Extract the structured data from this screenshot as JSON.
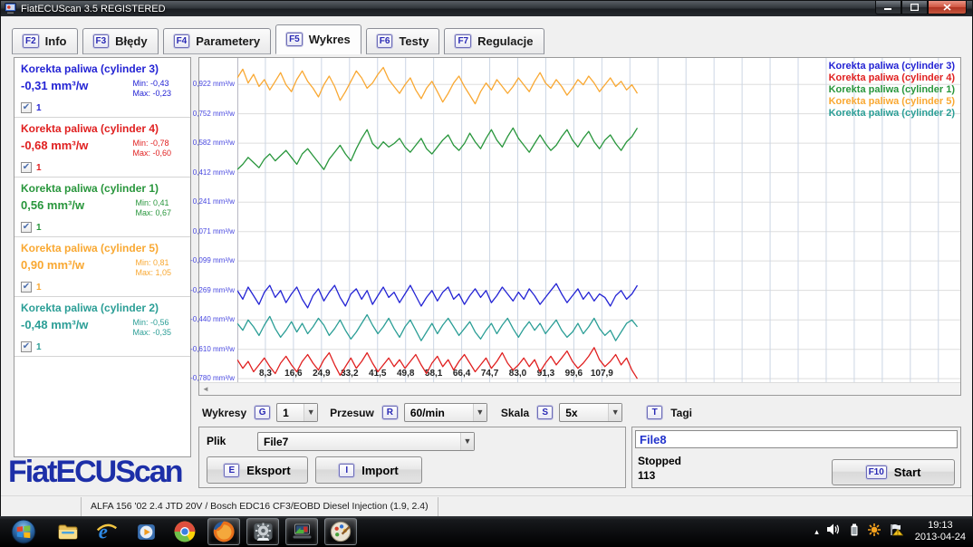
{
  "window": {
    "title": "FiatECUScan 3.5 REGISTERED"
  },
  "tabs": [
    {
      "key": "F2",
      "label": "Info",
      "active": false
    },
    {
      "key": "F3",
      "label": "Błędy",
      "active": false
    },
    {
      "key": "F4",
      "label": "Parametery",
      "active": false
    },
    {
      "key": "F5",
      "label": "Wykres",
      "active": true
    },
    {
      "key": "F6",
      "label": "Testy",
      "active": false
    },
    {
      "key": "F7",
      "label": "Regulacje",
      "active": false
    }
  ],
  "channels": [
    {
      "title": "Korekta paliwa (cylinder 3)",
      "value": "-0,31 mm³/w",
      "min": "Min: -0,43",
      "max": "Max: -0,23",
      "checkbox_label": "1",
      "checked": true,
      "color": "#2323d4"
    },
    {
      "title": "Korekta paliwa (cylinder 4)",
      "value": "-0,68 mm³/w",
      "min": "Min: -0,78",
      "max": "Max: -0,60",
      "checkbox_label": "1",
      "checked": true,
      "color": "#e02020"
    },
    {
      "title": "Korekta paliwa (cylinder 1)",
      "value": "0,56 mm³/w",
      "min": "Min: 0,41",
      "max": "Max: 0,67",
      "checkbox_label": "1",
      "checked": true,
      "color": "#28963c"
    },
    {
      "title": "Korekta paliwa (cylinder 5)",
      "value": "0,90 mm³/w",
      "min": "Min: 0,81",
      "max": "Max: 1,05",
      "checkbox_label": "1",
      "checked": true,
      "color": "#f9a832"
    },
    {
      "title": "Korekta paliwa (cylinder 2)",
      "value": "-0,48 mm³/w",
      "min": "Min: -0,56",
      "max": "Max: -0,35",
      "checkbox_label": "1",
      "checked": true,
      "color": "#2b9e96"
    }
  ],
  "chart_data": {
    "type": "line",
    "title": "",
    "xlabel": "",
    "ylabel": "mm³/w",
    "grid": true,
    "legend_position": "top-right",
    "xlim": [
      0,
      214
    ],
    "ylim": [
      -0.8,
      1.075
    ],
    "x_gridline_interval": 8.3,
    "x_step": 1.6,
    "xticks": [
      {
        "value": 8.3,
        "label": "8,3"
      },
      {
        "value": 16.6,
        "label": "16,6"
      },
      {
        "value": 24.9,
        "label": "24,9"
      },
      {
        "value": 33.2,
        "label": "33,2"
      },
      {
        "value": 41.5,
        "label": "41,5"
      },
      {
        "value": 49.8,
        "label": "49,8"
      },
      {
        "value": 58.1,
        "label": "58,1"
      },
      {
        "value": 66.4,
        "label": "66,4"
      },
      {
        "value": 74.7,
        "label": "74,7"
      },
      {
        "value": 83.0,
        "label": "83,0"
      },
      {
        "value": 91.3,
        "label": "91,3"
      },
      {
        "value": 99.6,
        "label": "99,6"
      },
      {
        "value": 107.9,
        "label": "107,9"
      }
    ],
    "yticks": [
      {
        "value": 0.922,
        "label": "0,922 mm³/w"
      },
      {
        "value": 0.752,
        "label": "0,752 mm³/w"
      },
      {
        "value": 0.582,
        "label": "0,582 mm³/w"
      },
      {
        "value": 0.412,
        "label": "0,412 mm³/w"
      },
      {
        "value": 0.241,
        "label": "0,241 mm³/w"
      },
      {
        "value": 0.071,
        "label": "0,071 mm³/w"
      },
      {
        "value": -0.099,
        "label": "-0,099 mm³/w"
      },
      {
        "value": -0.269,
        "label": "-0,269 mm³/w"
      },
      {
        "value": -0.44,
        "label": "-0,440 mm³/w"
      },
      {
        "value": -0.61,
        "label": "-0,610 mm³/w"
      },
      {
        "value": -0.78,
        "label": "-0,780 mm³/w"
      }
    ],
    "series": [
      {
        "name": "Korekta paliwa (cylinder 3)",
        "color": "#2323d4",
        "values": [
          -0.27,
          -0.32,
          -0.25,
          -0.3,
          -0.35,
          -0.28,
          -0.24,
          -0.31,
          -0.27,
          -0.34,
          -0.29,
          -0.25,
          -0.32,
          -0.37,
          -0.3,
          -0.26,
          -0.33,
          -0.28,
          -0.24,
          -0.31,
          -0.36,
          -0.29,
          -0.26,
          -0.32,
          -0.27,
          -0.35,
          -0.3,
          -0.25,
          -0.31,
          -0.28,
          -0.34,
          -0.29,
          -0.24,
          -0.3,
          -0.36,
          -0.31,
          -0.27,
          -0.33,
          -0.28,
          -0.25,
          -0.32,
          -0.29,
          -0.35,
          -0.3,
          -0.26,
          -0.31,
          -0.27,
          -0.34,
          -0.3,
          -0.25,
          -0.29,
          -0.33,
          -0.28,
          -0.32,
          -0.26,
          -0.3,
          -0.35,
          -0.31,
          -0.27,
          -0.23,
          -0.29,
          -0.34,
          -0.3,
          -0.26,
          -0.32,
          -0.28,
          -0.33,
          -0.29,
          -0.31,
          -0.36,
          -0.3,
          -0.27,
          -0.32,
          -0.29,
          -0.24
        ]
      },
      {
        "name": "Korekta paliwa (cylinder 4)",
        "color": "#e02020",
        "values": [
          -0.67,
          -0.72,
          -0.68,
          -0.74,
          -0.7,
          -0.66,
          -0.71,
          -0.75,
          -0.69,
          -0.65,
          -0.7,
          -0.74,
          -0.68,
          -0.64,
          -0.69,
          -0.73,
          -0.67,
          -0.63,
          -0.7,
          -0.76,
          -0.71,
          -0.66,
          -0.72,
          -0.68,
          -0.63,
          -0.69,
          -0.74,
          -0.7,
          -0.66,
          -0.71,
          -0.67,
          -0.72,
          -0.68,
          -0.64,
          -0.7,
          -0.75,
          -0.69,
          -0.65,
          -0.71,
          -0.67,
          -0.73,
          -0.68,
          -0.64,
          -0.69,
          -0.74,
          -0.7,
          -0.66,
          -0.72,
          -0.68,
          -0.63,
          -0.69,
          -0.73,
          -0.7,
          -0.66,
          -0.71,
          -0.67,
          -0.74,
          -0.69,
          -0.65,
          -0.7,
          -0.66,
          -0.62,
          -0.68,
          -0.72,
          -0.69,
          -0.65,
          -0.6,
          -0.67,
          -0.71,
          -0.68,
          -0.64,
          -0.7,
          -0.66,
          -0.73,
          -0.78
        ]
      },
      {
        "name": "Korekta paliwa (cylinder 1)",
        "color": "#28963c",
        "values": [
          0.43,
          0.46,
          0.5,
          0.47,
          0.44,
          0.49,
          0.52,
          0.48,
          0.51,
          0.54,
          0.5,
          0.46,
          0.52,
          0.55,
          0.51,
          0.47,
          0.43,
          0.49,
          0.53,
          0.57,
          0.52,
          0.48,
          0.55,
          0.61,
          0.66,
          0.58,
          0.55,
          0.59,
          0.56,
          0.58,
          0.61,
          0.56,
          0.53,
          0.57,
          0.61,
          0.55,
          0.52,
          0.56,
          0.6,
          0.63,
          0.57,
          0.54,
          0.58,
          0.64,
          0.59,
          0.55,
          0.61,
          0.66,
          0.6,
          0.56,
          0.62,
          0.67,
          0.61,
          0.57,
          0.53,
          0.58,
          0.63,
          0.58,
          0.54,
          0.57,
          0.62,
          0.66,
          0.6,
          0.56,
          0.61,
          0.65,
          0.59,
          0.55,
          0.6,
          0.63,
          0.58,
          0.54,
          0.59,
          0.62,
          0.67
        ]
      },
      {
        "name": "Korekta paliwa (cylinder 5)",
        "color": "#f9a832",
        "values": [
          0.96,
          1.01,
          0.93,
          0.98,
          0.91,
          0.95,
          0.89,
          0.94,
          0.99,
          0.92,
          0.88,
          0.95,
          1.0,
          0.94,
          0.9,
          0.85,
          0.92,
          0.97,
          0.91,
          0.83,
          0.88,
          0.94,
          1.0,
          0.96,
          0.9,
          0.93,
          0.98,
          1.02,
          0.95,
          0.91,
          0.87,
          0.92,
          0.96,
          0.89,
          0.84,
          0.9,
          0.94,
          0.88,
          0.82,
          0.87,
          0.93,
          0.97,
          0.91,
          0.86,
          0.81,
          0.88,
          0.93,
          0.89,
          0.95,
          0.91,
          0.87,
          0.91,
          0.96,
          0.92,
          0.88,
          0.94,
          0.99,
          0.93,
          0.9,
          0.95,
          0.91,
          0.86,
          0.9,
          0.95,
          0.92,
          0.97,
          0.93,
          0.88,
          0.92,
          0.96,
          0.91,
          0.94,
          0.89,
          0.92,
          0.87
        ]
      },
      {
        "name": "Korekta paliwa (cylinder 2)",
        "color": "#2b9e96",
        "values": [
          -0.46,
          -0.5,
          -0.44,
          -0.48,
          -0.53,
          -0.47,
          -0.42,
          -0.49,
          -0.54,
          -0.5,
          -0.45,
          -0.51,
          -0.46,
          -0.52,
          -0.48,
          -0.43,
          -0.47,
          -0.53,
          -0.49,
          -0.44,
          -0.5,
          -0.55,
          -0.51,
          -0.46,
          -0.41,
          -0.47,
          -0.52,
          -0.48,
          -0.43,
          -0.49,
          -0.54,
          -0.48,
          -0.44,
          -0.5,
          -0.56,
          -0.51,
          -0.46,
          -0.52,
          -0.47,
          -0.43,
          -0.48,
          -0.53,
          -0.49,
          -0.45,
          -0.51,
          -0.55,
          -0.5,
          -0.46,
          -0.52,
          -0.47,
          -0.43,
          -0.49,
          -0.54,
          -0.49,
          -0.45,
          -0.5,
          -0.46,
          -0.52,
          -0.48,
          -0.44,
          -0.5,
          -0.54,
          -0.51,
          -0.46,
          -0.52,
          -0.48,
          -0.43,
          -0.49,
          -0.53,
          -0.5,
          -0.56,
          -0.51,
          -0.46,
          -0.44,
          -0.48
        ]
      }
    ]
  },
  "controls": {
    "wykresy_label": "Wykresy",
    "wykresy_key": "G",
    "wykresy_value": "1",
    "przesuw_label": "Przesuw",
    "przesuw_key": "R",
    "przesuw_value": "60/min",
    "skala_label": "Skala",
    "skala_key": "S",
    "skala_value": "5x",
    "tagi_key": "T",
    "tagi_label": "Tagi"
  },
  "file_panel": {
    "plik_label": "Plik",
    "plik_value": "File7",
    "eksport_key": "E",
    "eksport_label": "Eksport",
    "import_key": "I",
    "import_label": "Import"
  },
  "session_panel": {
    "file_value": "File8",
    "status": "Stopped",
    "status_color": "#e01818",
    "count": "113",
    "count_color": "#1e8c3a",
    "start_key": "F10",
    "start_label": "Start"
  },
  "logo": "FiatECUScan",
  "status_bar": "ALFA 156 '02 2.4 JTD 20V / Bosch EDC16 CF3/EOBD Diesel Injection (1.9, 2.4)",
  "scrollbar": {
    "left_arrow": "◄"
  },
  "taskbar": {
    "icons": [
      {
        "name": "windows-start-orb",
        "active": false
      },
      {
        "name": "windows-explorer-icon",
        "active": false
      },
      {
        "name": "internet-explorer-icon",
        "active": false
      },
      {
        "name": "windows-media-player-icon",
        "active": false
      },
      {
        "name": "chrome-icon",
        "active": false
      },
      {
        "name": "firefox-icon",
        "active": true
      },
      {
        "name": "diagnostic-app-icon",
        "active": true
      },
      {
        "name": "ecu-scan-app-icon",
        "active": true
      },
      {
        "name": "graphics-app-icon",
        "active": true
      }
    ],
    "tray_expand": "▴",
    "time": "19:13",
    "date": "2013-04-24"
  }
}
